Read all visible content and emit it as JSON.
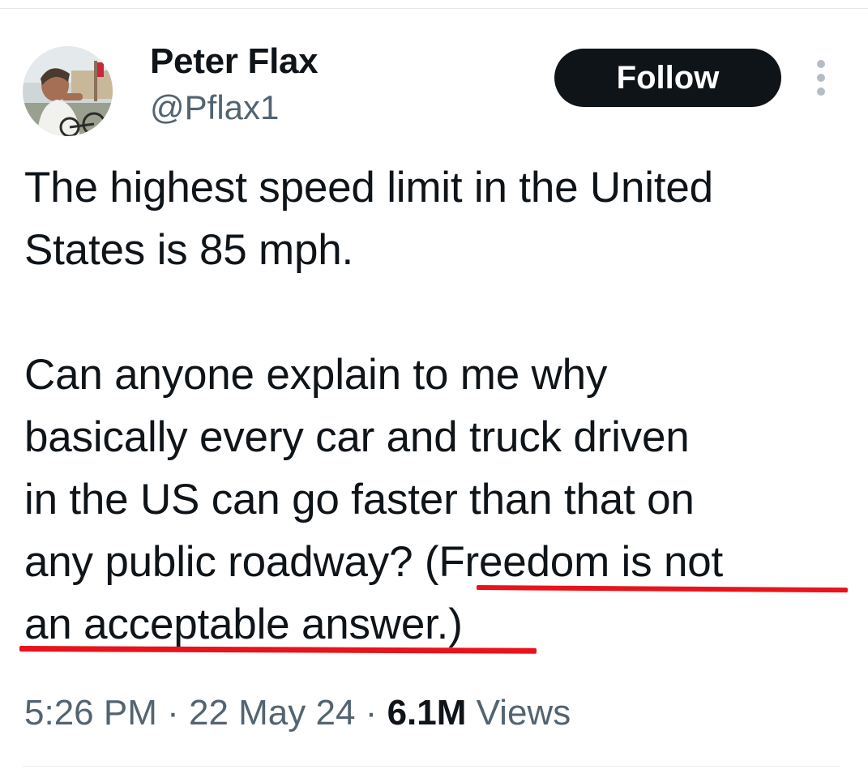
{
  "author": {
    "name": "Peter Flax",
    "handle": "@Pflax1"
  },
  "follow_button": {
    "label": "Follow"
  },
  "tweet": {
    "lines": [
      "The highest speed limit in the United",
      "States is 85 mph.",
      "",
      "Can anyone explain to me why",
      "basically every car and truck driven",
      "in the US can go faster than that on",
      "any public roadway? (Freedom is not",
      "an acceptable answer.)"
    ]
  },
  "meta": {
    "time": "5:26 PM",
    "separator": " · ",
    "date": "22 May 24",
    "views_count": "6.1M",
    "views_label": " Views"
  },
  "icons": {
    "more": "more-vertical-icon"
  },
  "colors": {
    "text": "#0f1419",
    "secondary": "#536471",
    "follow_bg": "#0f1419",
    "underline": "#e8131b"
  }
}
